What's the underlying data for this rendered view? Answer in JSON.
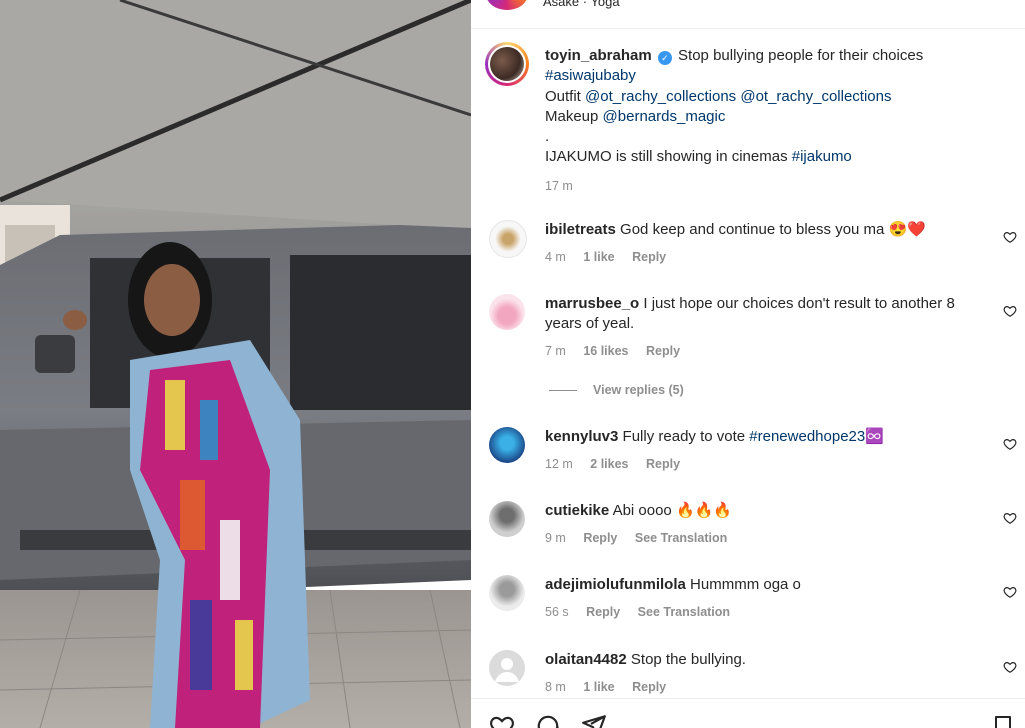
{
  "header": {
    "music": "Asake · Yoga"
  },
  "caption": {
    "username": "toyin_abraham",
    "text": "Stop bullying people for their choices",
    "hashtag1": "#asiwajubaby",
    "outfit_label": "Outfit",
    "outfit_tag1": "@ot_rachy_collections",
    "outfit_tag2": "@ot_rachy_collections",
    "makeup_label": "Makeup",
    "makeup_tag": "@bernards_magic",
    "dot": ".",
    "line2": "IJAKUMO is still showing in cinemas",
    "hashtag2": "#ijakumo",
    "time": "17 m"
  },
  "comments": [
    {
      "username": "ibiletreats",
      "text": "God keep and continue to bless you ma 😍❤️",
      "time": "4 m",
      "likes": "1 like",
      "action": "Reply",
      "extra": ""
    },
    {
      "username": "marrusbee_o",
      "text": "I just hope our choices don't result to another 8 years of yeal.",
      "time": "7 m",
      "likes": "16 likes",
      "action": "Reply",
      "extra": ""
    },
    {
      "username": "kennyluv3",
      "text": "Fully ready to vote",
      "link": "#renewedhope23",
      "emoji": "♾️",
      "time": "12 m",
      "likes": "2 likes",
      "action": "Reply",
      "extra": ""
    },
    {
      "username": "cutiekike",
      "text": "Abi oooo 🔥🔥🔥",
      "time": "9 m",
      "likes": "",
      "action": "Reply",
      "extra": "See Translation"
    },
    {
      "username": "adejimiolufunmilola",
      "text": "Hummmm oga o",
      "time": "56 s",
      "likes": "",
      "action": "Reply",
      "extra": "See Translation"
    },
    {
      "username": "olaitan4482",
      "text": "Stop the bullying.",
      "time": "8 m",
      "likes": "1 like",
      "action": "Reply",
      "extra": ""
    }
  ],
  "view_replies": "View replies (5)",
  "colors": {
    "link": "#00376b",
    "meta": "#8e8e8e",
    "verified": "#3897f0"
  },
  "icons": [
    "heart-icon",
    "comment-icon",
    "share-icon",
    "bookmark-icon",
    "verified-icon"
  ]
}
